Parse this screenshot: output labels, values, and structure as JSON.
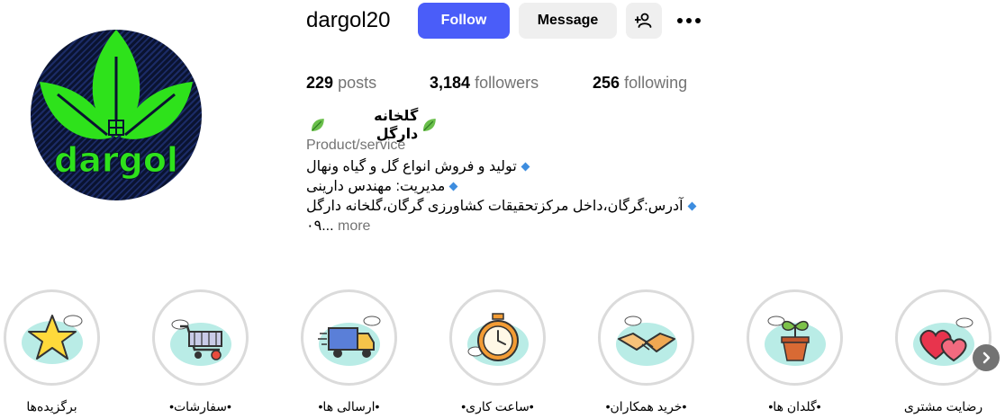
{
  "profile": {
    "username": "dargol20",
    "follow_label": "Follow",
    "message_label": "Message",
    "avatar_text": "dargol"
  },
  "stats": {
    "posts_count": "229",
    "posts_label": "posts",
    "followers_count": "3,184",
    "followers_label": "followers",
    "following_count": "256",
    "following_label": "following"
  },
  "bio": {
    "name": "گلخانه دارگل",
    "category": "Product/service",
    "lines": [
      "تولید و فروش انواع گل و گیاه ونهال",
      "مدیریت: مهندس دارینی",
      "آدرس:گرگان،داخل مرکزتحقیقات کشاورزی گرگان،گلخانه دارگل"
    ],
    "last_line_start": "۰۹...",
    "more_label": "more"
  },
  "highlights": [
    {
      "label": "برگزیده‌ها",
      "icon": "star-icon"
    },
    {
      "label": "•سفارشات•",
      "icon": "shopping-cart-icon"
    },
    {
      "label": "•ارسالی ها•",
      "icon": "delivery-truck-icon"
    },
    {
      "label": "•ساعت کاری•",
      "icon": "clock-icon"
    },
    {
      "label": "•خرید همکاران•",
      "icon": "handshake-icon"
    },
    {
      "label": "•گلدان ها•",
      "icon": "potted-plant-icon"
    },
    {
      "label": "رضایت مشتری",
      "icon": "hearts-icon"
    }
  ],
  "colors": {
    "follow_button": "#4a5df9",
    "secondary_button": "#efefef",
    "muted_text": "#737373",
    "avatar_green": "#2ee21b",
    "bullet_blue": "#3d8ddf"
  }
}
